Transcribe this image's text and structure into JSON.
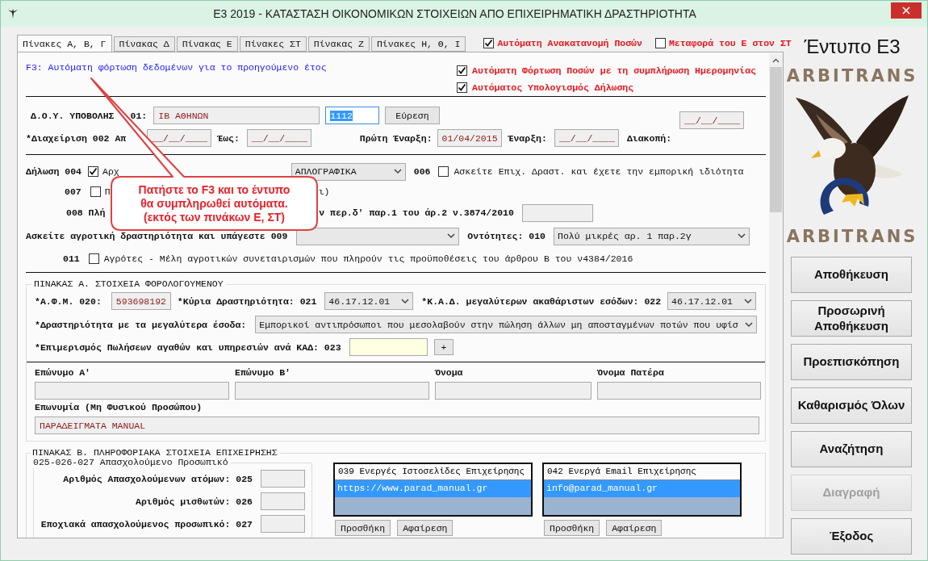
{
  "window": {
    "title": "Ε3 2019 - ΚΑΤΑΣΤΑΣΗ ΟΙΚΟΝΟΜΙΚΩΝ ΣΤΟΙΧΕΙΩΝ ΑΠΟ ΕΠΙΧΕΙΡΗΜΑΤΙΚΗ ΔΡΑΣΤΗΡΙΟΤΗΤΑ"
  },
  "tabs": [
    {
      "label": "Πίνακες Α, Β, Γ",
      "selected": true
    },
    {
      "label": "Πίνακας Δ",
      "selected": false
    },
    {
      "label": "Πίνακας Ε",
      "selected": false
    },
    {
      "label": "Πίνακες ΣΤ",
      "selected": false
    },
    {
      "label": "Πίνακας Ζ",
      "selected": false
    },
    {
      "label": "Πίνακες Η, Θ, Ι",
      "selected": false
    }
  ],
  "top_options": [
    {
      "label": "Αυτόματη Ανακατανομή Ποσών",
      "checked": true
    },
    {
      "label": "Μεταφορά του Ε στον ΣΤ",
      "checked": false
    }
  ],
  "hint": "F3: Αυτόματη φόρτωση δεδομένων για το προηγούμενο έτος",
  "auto_options": [
    {
      "label": "Αυτόματη Φόρτωση Ποσών με τη συμπλήρωση Ημερομηνίας",
      "checked": true
    },
    {
      "label": "Αυτόματος Υπολογισμός Δήλωσης",
      "checked": true
    }
  ],
  "doy": {
    "label": "Δ.Ο.Υ. ΥΠΟΒΟΛΗΣ",
    "label_tail": "01:",
    "name": "ΙΒ ΑΘΗΝΩΝ",
    "code": "1112",
    "find_button": "Εύρεση"
  },
  "management": {
    "from_label": "*Διαχείριση  002 Απ",
    "from": "__/__/____",
    "to_label": "Έως:",
    "to": "__/__/____",
    "first_start_label": "Πρώτη Έναρξη:",
    "first_start": "01/04/2015",
    "start_label": "Έναρξη:",
    "start": "__/__/____",
    "stop_label": "Διακοπή:",
    "stop": "__/__/____"
  },
  "declaration": {
    "label": "Δήλωση 004",
    "checked": true,
    "option_label": "Αρχ",
    "book_type": "ΑΠΛΟΓΡΑΦΙΚΑ",
    "code_006": "006",
    "checked_006": false,
    "label_006": "Ασκείτε Επιχ. Δραστ. και έχετε την εμπορική ιδιότητα"
  },
  "row_007": {
    "code": "007",
    "checked": false,
    "label": "Π",
    "tail": "ι)"
  },
  "row_008": {
    "label": "008 Πλή",
    "tail": "ν περ.δ' παρ.1 του άρ.2 ν.3874/2010"
  },
  "row_009": {
    "label": "Ασκείτε αγροτική δραστηριότητα και υπάγεστε 009",
    "entities_label": "Οντότητες: 010",
    "entities_value": "Πολύ μικρές αρ. 1 παρ.2γ"
  },
  "row_011": {
    "code": "011",
    "checked": false,
    "label": "Αγρότες - Μέλη αγροτικών συνεταιρισμών που πληρούν τις προϋποθέσεις του άρθρου Β του ν4384/2016"
  },
  "table_a": {
    "title": "ΠΙΝΑΚΑΣ Α. ΣΤΟΙΧΕΙΑ ΦΟΡΟΛΟΓΟΥΜΕΝΟΥ",
    "afm_label": "*Α.Φ.Μ. 020:",
    "afm": "593698192",
    "main_label": "*Κύρια Δραστηριότητα: 021",
    "main": "46.17.12.01",
    "kad_label": "*Κ.Α.Δ. μεγαλύτερων ακαθάριστων εσόδων: 022",
    "kad": "46.17.12.01",
    "income_label": "*Δραστηριότητα με τα μεγαλύτερα έσοδα:",
    "income": "Εμπορικοί αντιπρόσωποι που μεσολαβούν στην πώληση άλλων μη αποσταγμένων ποτών που υφίσ",
    "split_label": "*Επιμερισμός Πωλήσεων αγαθών και υπηρεσιών ανά ΚΑΔ: 023",
    "plus_button": "+",
    "names": [
      {
        "label": "Επώνυμο Α'"
      },
      {
        "label": "Επώνυμο Β'"
      },
      {
        "label": "Όνομα"
      },
      {
        "label": "Όνομα Πατέρα"
      }
    ],
    "company_label": "Επωνυμία (Μη Φυσικού Προσώπου)",
    "company": "ΠΑΡΑΔΕΙΓΜΑΤΑ MANUAL"
  },
  "table_b": {
    "title": "ΠΙΝΑΚΑΣ Β. ΠΛΗΡΟΦΟΡΙΑΚΑ ΣΤΟΙΧΕΙΑ ΕΠΙΧΕΙΡΗΣΗΣ",
    "staff_title": "025-026-027 Απασχολούμενο Προσωπικό",
    "staff": [
      {
        "label": "Αριθμός Απασχολούμενων ατόμων: 025"
      },
      {
        "label": "Αριθμός μισθωτών: 026"
      },
      {
        "label": "Εποχιακά απασχολούμενος προσωπικό: 027"
      }
    ],
    "lists": [
      {
        "title": "039 Ενεργές Ιστοσελίδες Επιχείρησης",
        "items": [
          {
            "text": "https://www.parad_manual.gr",
            "selected": true
          }
        ],
        "buttons": [
          "Προσθήκη",
          "Αφαίρεση"
        ]
      },
      {
        "title": "042 Ενεργά Email Επιχείρησης",
        "items": [
          {
            "text": "info@parad_manual.gr",
            "selected": true
          }
        ],
        "buttons": [
          "Προσθήκη",
          "Αφαίρεση"
        ]
      }
    ]
  },
  "callout": [
    "Πατήστε το F3 και το έντυπο",
    "θα συμπληρωθεί  αυτόματα.",
    "(εκτός των πινάκων Ε, ΣΤ)"
  ],
  "side": {
    "title": "Έντυπο Ε3",
    "logo_top": "ARBITRANS",
    "logo_bottom": "ARBITRANS",
    "buttons": [
      {
        "label": "Αποθήκευση",
        "disabled": false
      },
      {
        "label": "Προσωρινή Αποθήκευση",
        "disabled": false
      },
      {
        "label": "Προεπισκόπηση",
        "disabled": false
      },
      {
        "label": "Καθαρισμός Όλων",
        "disabled": false
      },
      {
        "label": "Αναζήτηση",
        "disabled": false
      },
      {
        "label": "Διαγραφή",
        "disabled": true
      },
      {
        "label": "Έξοδος",
        "disabled": false
      }
    ]
  }
}
